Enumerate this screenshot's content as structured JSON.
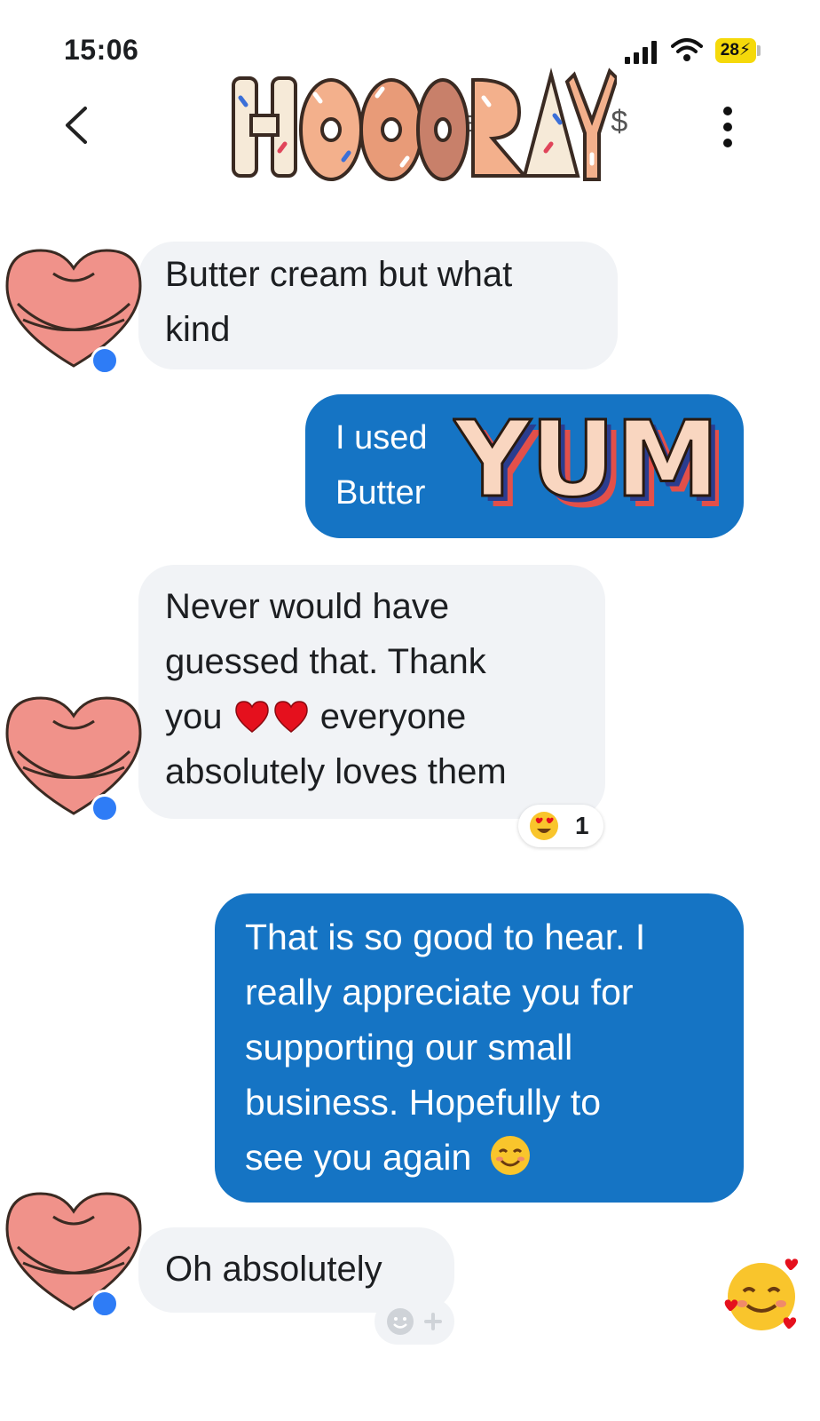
{
  "status_bar": {
    "time": "15:06",
    "battery": "28"
  },
  "header": {
    "title_fragment": "e",
    "title_suffix": "$",
    "sticker_text": "HOORAY"
  },
  "messages": [
    {
      "from": "them",
      "lines": [
        "Butter cream but what",
        "kind"
      ]
    },
    {
      "from": "me",
      "lines": [
        "I used",
        "Butter"
      ],
      "sticker_text": "YUM"
    },
    {
      "from": "them",
      "lines": [
        "Never would have",
        "guessed that. Thank",
        "you",
        "everyone",
        "absolutely loves them"
      ],
      "reaction_count": "1"
    },
    {
      "from": "me",
      "lines": [
        "That is so good to hear. I",
        "really appreciate you for",
        "supporting our small",
        "business. Hopefully to",
        "see you again"
      ]
    },
    {
      "from": "them",
      "lines": [
        "Oh absolutely"
      ]
    }
  ],
  "icons": {
    "back": "chevron-left-icon",
    "more": "more-vertical-icon",
    "signal": "signal-icon",
    "wifi": "wifi-icon",
    "messenger": "messenger-badge-icon",
    "heart": "red-heart-emoji",
    "heart_eyes": "heart-eyes-emoji",
    "smiling": "smiling-face-emoji",
    "smiling_hearts": "smiling-face-with-hearts-emoji",
    "add_reaction": "add-reaction-icon"
  },
  "colors": {
    "outgoing_bubble": "#1574c4",
    "incoming_bubble": "#f1f3f6",
    "messenger_badge": "#2e7cf6"
  }
}
